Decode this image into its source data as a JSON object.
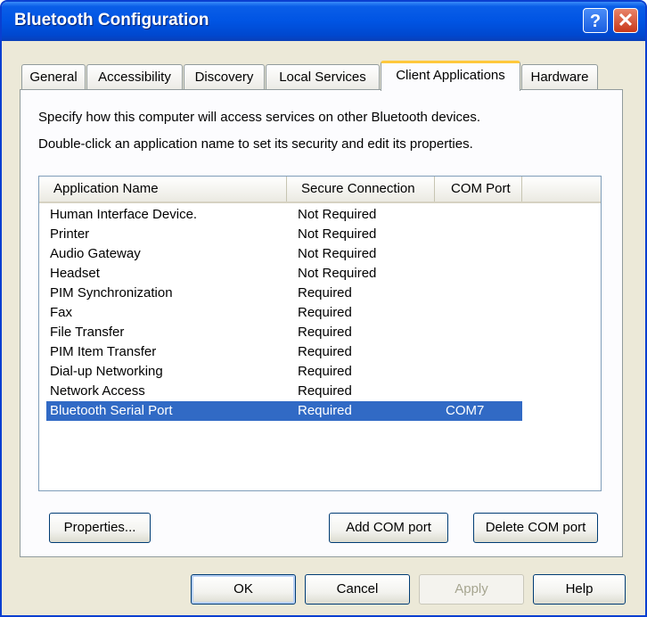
{
  "window": {
    "title": "Bluetooth Configuration",
    "help_glyph": "?",
    "close_glyph": "✕"
  },
  "tabs": [
    {
      "label": "General"
    },
    {
      "label": "Accessibility"
    },
    {
      "label": "Discovery"
    },
    {
      "label": "Local Services"
    },
    {
      "label": "Client Applications",
      "active": true
    },
    {
      "label": "Hardware"
    }
  ],
  "panel": {
    "description_1": "Specify how this computer will access services on other Bluetooth devices.",
    "description_2": "Double-click an application name to set its security and edit its properties."
  },
  "list": {
    "columns": [
      "Application Name",
      "Secure Connection",
      "COM Port"
    ],
    "rows": [
      {
        "name": "Human Interface Device.",
        "secure": "Not Required",
        "port": ""
      },
      {
        "name": "Printer",
        "secure": "Not Required",
        "port": ""
      },
      {
        "name": "Audio Gateway",
        "secure": "Not Required",
        "port": ""
      },
      {
        "name": "Headset",
        "secure": "Not Required",
        "port": ""
      },
      {
        "name": "PIM Synchronization",
        "secure": "Required",
        "port": ""
      },
      {
        "name": "Fax",
        "secure": "Required",
        "port": ""
      },
      {
        "name": "File Transfer",
        "secure": "Required",
        "port": ""
      },
      {
        "name": "PIM Item Transfer",
        "secure": "Required",
        "port": ""
      },
      {
        "name": "Dial-up Networking",
        "secure": "Required",
        "port": ""
      },
      {
        "name": "Network Access",
        "secure": "Required",
        "port": ""
      },
      {
        "name": "Bluetooth Serial Port",
        "secure": "Required",
        "port": "COM7",
        "selected": true
      }
    ]
  },
  "buttons": {
    "properties": "Properties...",
    "add_com_port": "Add COM port",
    "delete_com_port": "Delete COM port",
    "ok": "OK",
    "cancel": "Cancel",
    "apply": "Apply",
    "help": "Help"
  },
  "colors": {
    "titlebar": "#0054e3",
    "selection": "#316ac5",
    "active_tab_accent": "#ffc83c"
  }
}
